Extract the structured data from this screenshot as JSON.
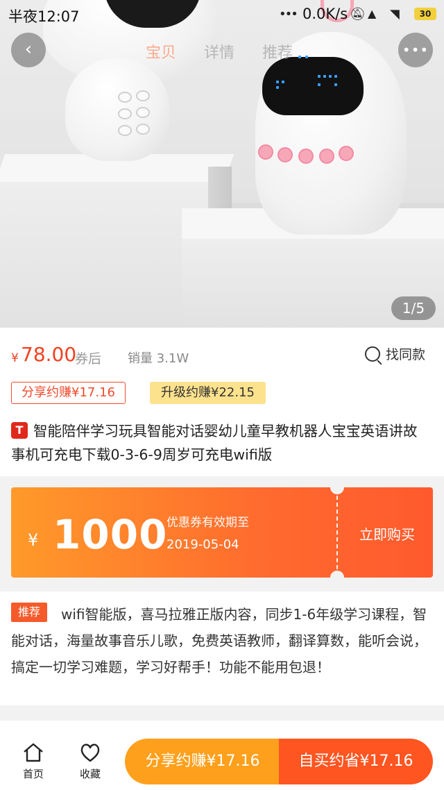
{
  "status_bar": {
    "time": "半夜12:07",
    "network_speed": "0.0K/s",
    "battery_level": "30",
    "icons": [
      "dots-icon",
      "mute-icon",
      "hd-signal-icon",
      "wifi-icon",
      "battery-icon"
    ]
  },
  "nav": {
    "back_icon": "chevron-left-icon",
    "tabs": [
      {
        "label": "宝贝",
        "active": true
      },
      {
        "label": "详情",
        "active": false
      },
      {
        "label": "推荐",
        "active": false
      }
    ],
    "more_icon": "more-horizontal-icon"
  },
  "gallery": {
    "page_indicator": "1/5"
  },
  "price": {
    "symbol": "¥",
    "value": "78.00",
    "suffix": "券后",
    "sales": "销量 3.1W",
    "find_same_label": "找同款"
  },
  "tags": {
    "share_earn": "分享约赚¥17.16",
    "upgrade_earn": "升级约赚¥22.15"
  },
  "product": {
    "platform_badge": "T",
    "title": "智能陪伴学习玩具智能对话婴幼儿童早教机器人宝宝英语讲故事机可充电下载0-3-6-9周岁可充电wifi版"
  },
  "coupon": {
    "currency": "¥",
    "amount": "1000",
    "validity_label": "优惠券有效期至",
    "validity_date": "2019-05-04",
    "buy_label": "立即购买"
  },
  "recommend": {
    "badge": "推荐",
    "text": "wifi智能版，喜马拉雅正版内容，同步1-6年级学习课程，智能对话，海量故事音乐儿歌，免费英语教师，翻译算数，能听会说，搞定一切学习难题，学习好帮手！功能不能用包退！"
  },
  "bottom_bar": {
    "home_label": "首页",
    "favorite_label": "收藏",
    "share_button": "分享约赚¥17.16",
    "buy_button": "自买约省¥17.16"
  },
  "colors": {
    "price": "#f2401f",
    "coupon_start": "#ff9a2a",
    "coupon_end": "#ff5a2e",
    "share_button": "#ffa01d",
    "buy_button": "#ff5521",
    "upgrade_tag": "#fde28d"
  }
}
